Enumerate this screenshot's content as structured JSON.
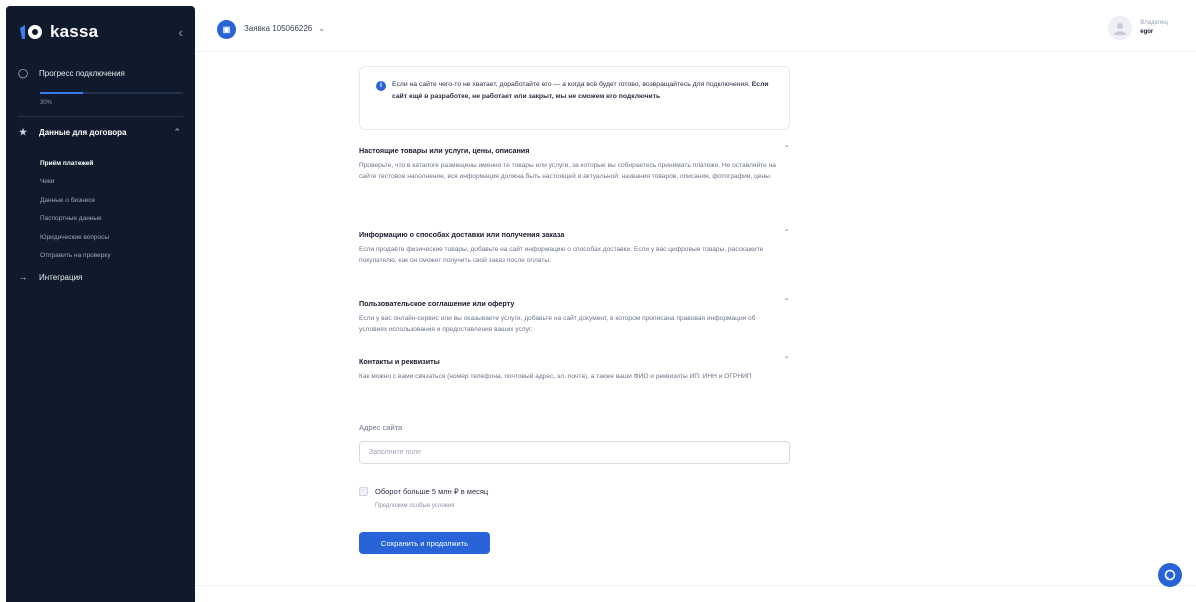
{
  "brand": {
    "name": "kassa",
    "accent": "#2864d8",
    "sidebar_bg": "#0f1b2d"
  },
  "sidebar": {
    "progress": {
      "label": "Прогресс подключения",
      "percent_text": "30%",
      "value": 0.3
    },
    "contract": {
      "label": "Данные для договора",
      "items": [
        {
          "label": "Приём платежей",
          "active": true
        },
        {
          "label": "Чеки",
          "active": false
        },
        {
          "label": "Данные о бизнесе",
          "active": false
        },
        {
          "label": "Паспортные данные",
          "active": false
        },
        {
          "label": "Юридические вопросы",
          "active": false
        },
        {
          "label": "Отправить на проверку",
          "active": false
        }
      ]
    },
    "integration": {
      "label": "Интеграция"
    }
  },
  "topbar": {
    "app_title": "Заявка 105066226",
    "user": {
      "role": "Владелец",
      "name": "egor"
    }
  },
  "notice": {
    "text": "Если на сайте чего-то не хватает, доработайте его — а когда всё будет готово, возвращайтесь для подключения. ",
    "bold": "Если сайт ещё в разработке, не работает или закрыт, мы не сможем его подключить"
  },
  "sections": [
    {
      "title": "Настоящие товары или услуги, цены, описания",
      "body": "Проверьте, что в каталоге размещены именно те товары или услуги, за которые вы собираетесь принимать платежи. Не оставляйте на сайте тестовое наполнение, вся информация должна быть настоящей и актуальной: названия товаров, описания, фотографии, цены."
    },
    {
      "title": "Информацию о способах доставки или получения заказа",
      "body": "Если продаёте физические товары, добавьте на сайт информацию о способах доставки. Если у вас цифровые товары, расскажите покупателю, как он сможет получить свой заказ после оплаты."
    },
    {
      "title": "Пользовательское соглашение или оферту",
      "body": "Если у вас онлайн-сервис или вы оказываете услуги, добавьте на сайт документ, в котором прописана правовая информация об условиях использования и предоставления ваших услуг."
    },
    {
      "title": "Контакты и реквизиты",
      "body": "Как можно с вами связаться (номер телефона, почтовый адрес, эл. почта), а также ваши ФИО и реквизиты ИП: ИНН и ОГРНИП"
    }
  ],
  "form": {
    "site_label": "Адрес сайта",
    "site_placeholder": "Заполните поле",
    "site_value": "",
    "turnover_label": "Оборот больше 5 млн ₽ в месяц",
    "turnover_hint": "Предложим особые условия",
    "submit_label": "Сохранить и продолжить"
  }
}
